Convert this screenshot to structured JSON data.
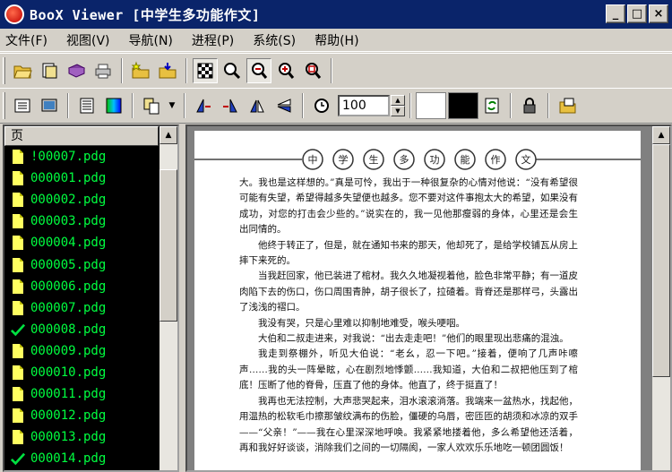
{
  "window": {
    "title": "BooX Viewer [中学生多功能作文]",
    "minimize": "_",
    "maximize": "□",
    "close": "×"
  },
  "menu": [
    {
      "label": "文件(F)"
    },
    {
      "label": "视图(V)"
    },
    {
      "label": "导航(N)"
    },
    {
      "label": "进程(P)"
    },
    {
      "label": "系统(S)"
    },
    {
      "label": "帮助(H)"
    }
  ],
  "toolbar2": {
    "zoom_value": "100",
    "fg_color": "#ffffff",
    "bg_color": "#000000"
  },
  "filepanel": {
    "header": "页",
    "files": [
      {
        "name": "!00007.pdg",
        "checked": false
      },
      {
        "name": "000001.pdg",
        "checked": false
      },
      {
        "name": "000002.pdg",
        "checked": false
      },
      {
        "name": "000003.pdg",
        "checked": false
      },
      {
        "name": "000004.pdg",
        "checked": false
      },
      {
        "name": "000005.pdg",
        "checked": false
      },
      {
        "name": "000006.pdg",
        "checked": false
      },
      {
        "name": "000007.pdg",
        "checked": false
      },
      {
        "name": "000008.pdg",
        "checked": true
      },
      {
        "name": "000009.pdg",
        "checked": false
      },
      {
        "name": "000010.pdg",
        "checked": false
      },
      {
        "name": "000011.pdg",
        "checked": false
      },
      {
        "name": "000012.pdg",
        "checked": false
      },
      {
        "name": "000013.pdg",
        "checked": false
      },
      {
        "name": "000014.pdg",
        "checked": true
      }
    ]
  },
  "document": {
    "header_glyphs": [
      "中",
      "学",
      "生",
      "多",
      "功",
      "能",
      "作",
      "文"
    ],
    "paragraphs": [
      "大。我也是这样想的。”真是可怜，我出于一种很复杂的心情对他说：“没有希望很可能有失望，希望得越多失望便也越多。您不要对这件事抱太大的希望，如果没有成功，对您的打击会少些的。”说实在的，我一见他那瘦弱的身体，心里还是会生出同情的。",
      "他终于转正了，但是，就在通知书来的那天，他却死了，是给学校铺瓦从房上摔下来死的。",
      "当我赶回家，他已装进了棺材。我久久地凝视着他，脸色非常平静；有一道皮肉陷下去的伤口，伤口周围青肿，胡子很长了，拉碴着。背脊还是那样弓，头露出了浅浅的褶口。",
      "我没有哭，只是心里难以抑制地难受，喉头哽咽。",
      "大伯和二叔走进来，对我说：“出去走走吧！”他们的眼里现出悲痛的混浊。",
      "我走到祭棚外，听见大伯说：“老幺，忍一下吧。”接着，便响了几声咔嚓声……我的头一阵晕眩，心在剧烈地悸颤……我知道，大伯和二叔把他压到了棺底！压断了他的脊骨，压直了他的身体。他直了，终于挺直了！",
      "我再也无法控制，大声悲哭起来，泪水滚滚淌落。我端来一盆热水，找起他，用温热的松软毛巾擦那皱纹满布的伤脸，僵硬的乌唇，密匝匝的胡须和冰凉的双手——“父亲！”——我在心里深深地呼唤。我紧紧地搂着他，多么希望他还活着，再和我好好谈谈，消除我们之间的一切隔阂，一家人欢欢乐乐地吃一顿团圆饭！"
    ]
  }
}
